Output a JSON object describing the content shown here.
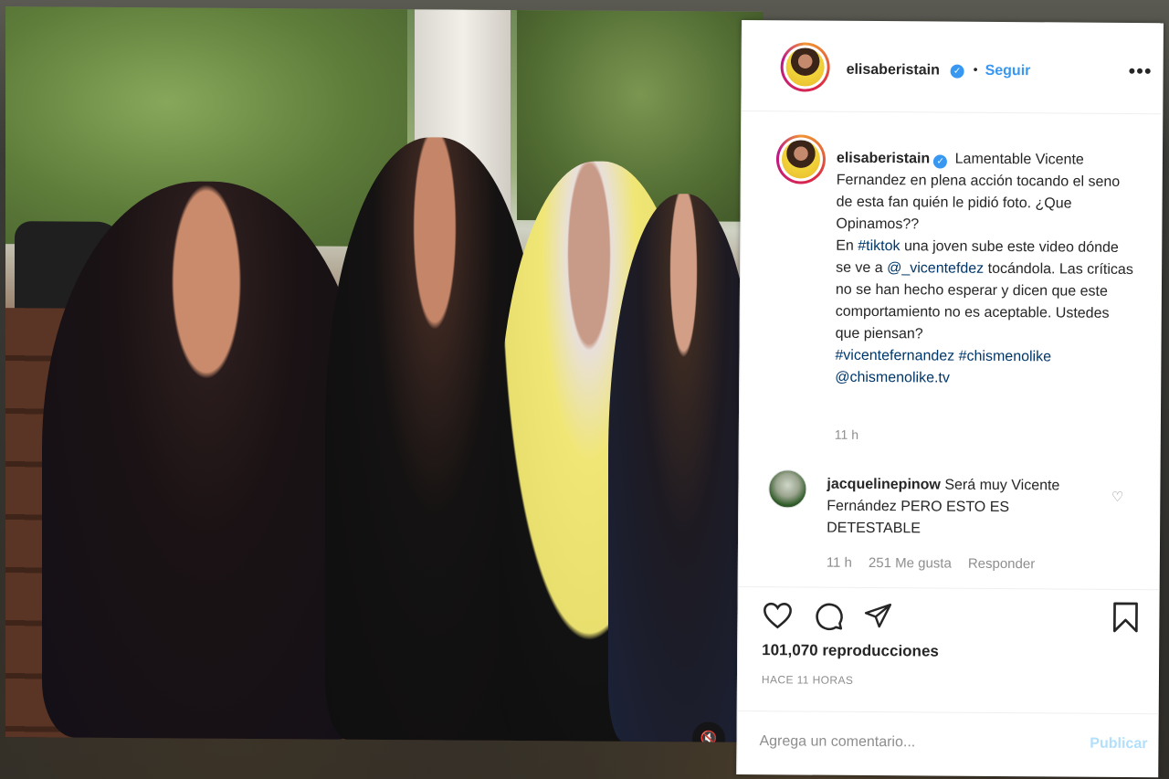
{
  "post": {
    "username": "elisaberistain",
    "follow_label": "Seguir",
    "dot": "•",
    "more_label": "•••"
  },
  "caption": {
    "username": "elisaberistain",
    "text_1": "Lamentable Vicente Fernandez en plena acción tocando el seno de esta fan quién le pidió foto. ¿Que Opinamos??",
    "text_2a": "En ",
    "hashtag_tiktok": "#tiktok",
    "text_2b": " una joven sube este video dónde se ve a ",
    "mention_vicente": "@_vicentefdez",
    "text_2c": " tocándola. Las críticas no se han hecho esperar y dicen que este comportamiento no es aceptable. Ustedes que piensan?",
    "hashtag_vicente": "#vicentefernandez",
    "hashtag_chismes": "#chismenolike",
    "mention_chismes": "@chismenolike.tv",
    "time": "11 h"
  },
  "comment": {
    "username": "jacquelinepinow",
    "text": "Será muy Vicente Fernández PERO ESTO ES DETESTABLE",
    "time": "11 h",
    "likes": "251 Me gusta",
    "reply_label": "Responder"
  },
  "stats": {
    "views": "101,070 reproducciones",
    "ago": "HACE 11 HORAS"
  },
  "add_comment": {
    "placeholder": "Agrega un comentario...",
    "post_label": "Publicar"
  },
  "icons": {
    "verified": "✓",
    "mute": "🔇",
    "heart_small": "♡"
  },
  "colors": {
    "accent": "#3897f0",
    "link": "#00376b",
    "muted": "#8e8e8e",
    "publish_disabled": "#b2dffc"
  }
}
